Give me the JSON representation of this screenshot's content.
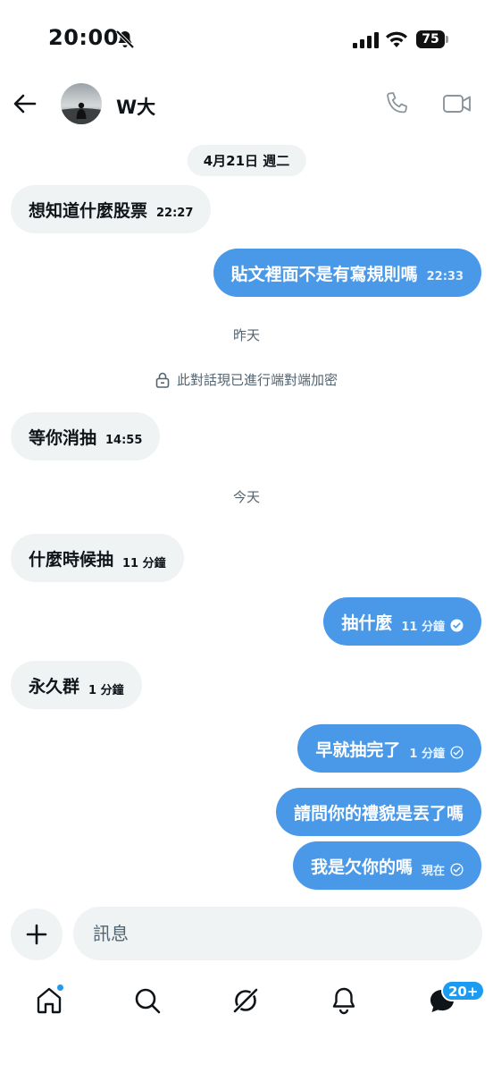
{
  "status_bar": {
    "time": "20:00",
    "battery": "75"
  },
  "header": {
    "contact_name": "W大"
  },
  "date_pill": "4月21日 週二",
  "messages": [
    {
      "text": "想知道什麼股票",
      "time": "22:27"
    },
    {
      "text": "貼文裡面不是有寫規則嗎",
      "time": "22:33"
    },
    {
      "text": "等你消抽",
      "time": "14:55"
    },
    {
      "text": "什麼時候抽",
      "time": "11 分鐘"
    },
    {
      "text": "抽什麼",
      "time": "11 分鐘"
    },
    {
      "text": "永久群",
      "time": "1 分鐘"
    },
    {
      "text": "早就抽完了",
      "time": "1 分鐘"
    },
    {
      "text": "請問你的禮貌是丟了嗎",
      "time": ""
    },
    {
      "text": "我是欠你的嗎",
      "time": "現在"
    }
  ],
  "day_labels": {
    "yesterday": "昨天",
    "today": "今天"
  },
  "encryption_note": "此對話現已進行端對端加密",
  "composer": {
    "placeholder": "訊息"
  },
  "nav": {
    "messages_badge": "20+"
  },
  "colors": {
    "accent": "#1d9bf0",
    "outgoing_bubble": "#4a99e9",
    "incoming_bubble": "#eff3f4"
  }
}
